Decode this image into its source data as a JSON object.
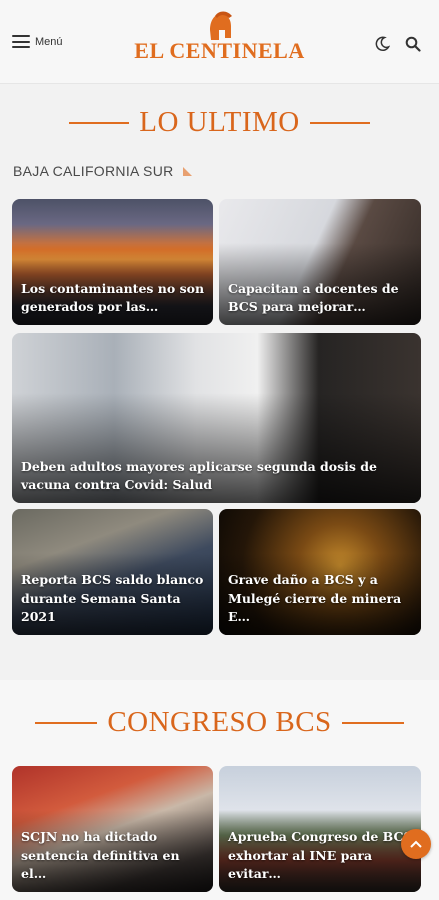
{
  "header": {
    "menu_label": "Menú",
    "logo_text": "EL CENTINELA",
    "brand_color": "#e06d1f"
  },
  "section1": {
    "title": "LO ULTIMO",
    "subheading": "BAJA CALIFORNIA SUR",
    "cards": [
      {
        "caption": "Los contaminantes no son generados por las…"
      },
      {
        "caption": "Capacitan a docentes de BCS para mejorar…"
      },
      {
        "caption": "Deben adultos mayores aplicarse segunda dosis de vacuna contra Covid: Salud"
      },
      {
        "caption": "Reporta BCS saldo blanco durante Semana Santa 2021"
      },
      {
        "caption": "Grave daño a BCS y a Mulegé cierre de minera E…"
      }
    ]
  },
  "section2": {
    "title": "CONGRESO BCS",
    "cards": [
      {
        "caption": "SCJN no ha dictado sentencia definitiva en el…"
      },
      {
        "caption": "Aprueba Congreso de BCS exhortar al INE para evitar…"
      }
    ]
  },
  "icons": {
    "menu": "hamburger-icon",
    "logo": "spartan-helmet-icon",
    "theme": "moon-icon",
    "search": "search-icon",
    "section_flag": "triangle-icon",
    "scroll_top": "chevron-up-icon"
  }
}
